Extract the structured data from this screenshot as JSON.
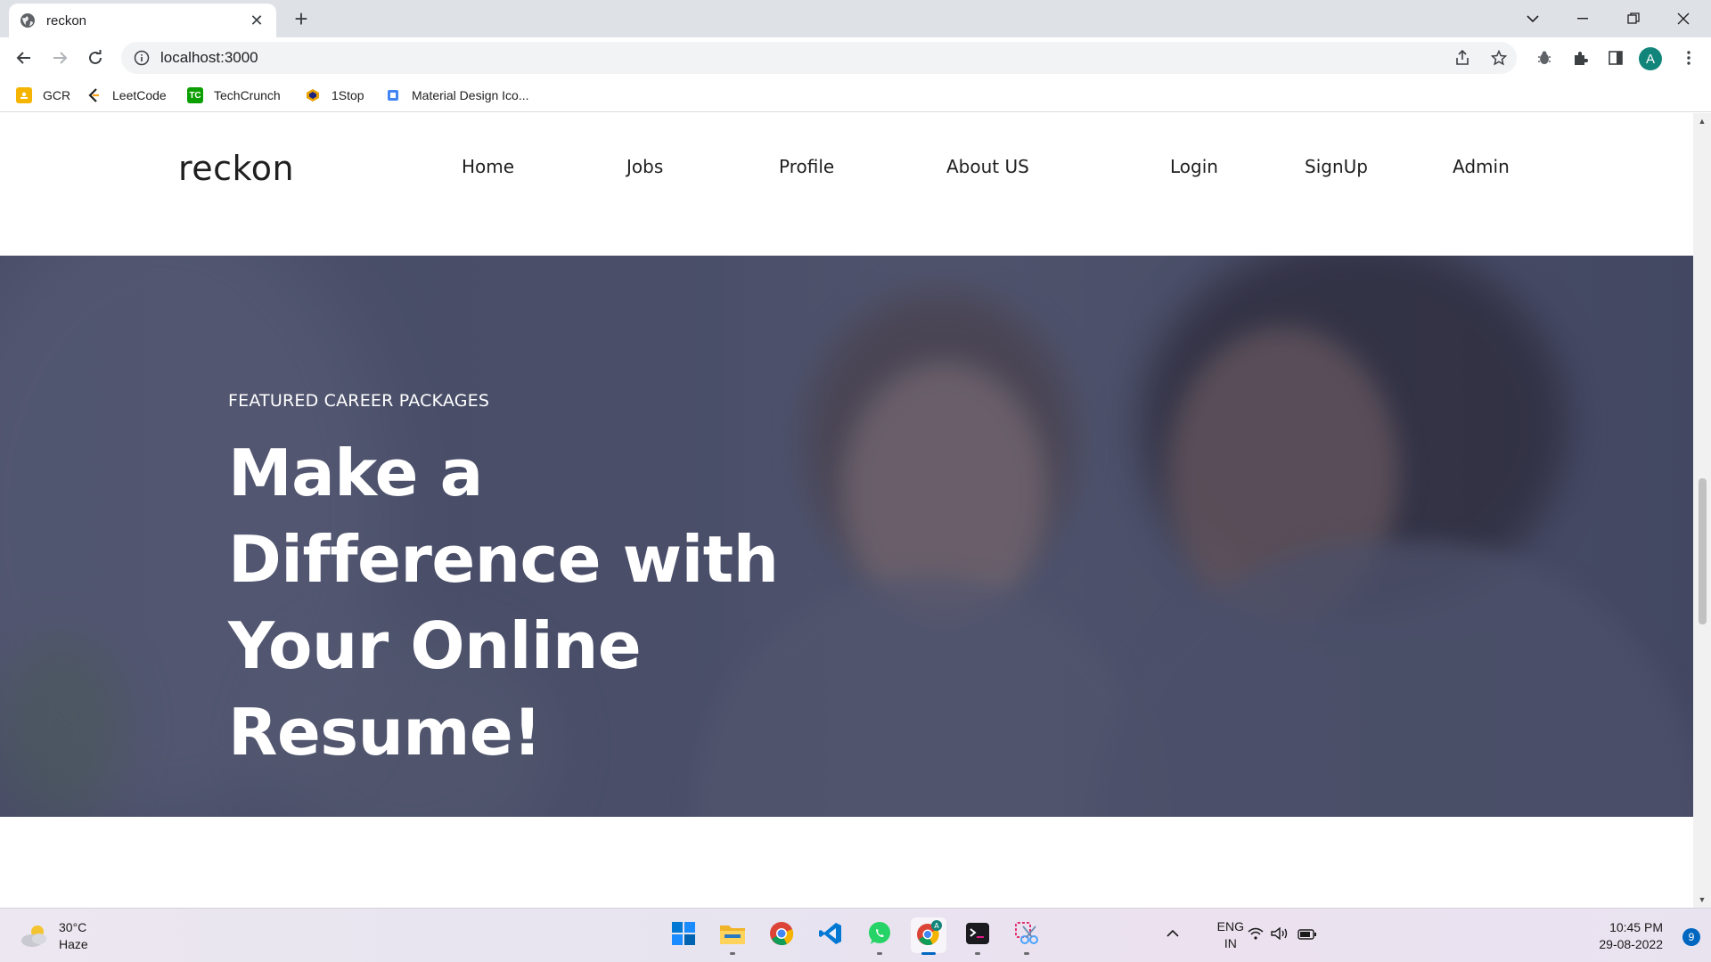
{
  "browser": {
    "tab_title": "reckon",
    "tab_close": "✕",
    "new_tab": "+",
    "url": "localhost:3000",
    "profile_initial": "A",
    "bookmarks": [
      {
        "label": "GCR",
        "icon": "google-classroom-icon",
        "color": "#f4b400"
      },
      {
        "label": "LeetCode",
        "icon": "leetcode-icon",
        "color": "#ffa116"
      },
      {
        "label": "TechCrunch",
        "icon": "techcrunch-icon",
        "color": "#0a9e01"
      },
      {
        "label": "1Stop",
        "icon": "1stop-icon",
        "color": "#e8a200"
      },
      {
        "label": "Material Design Ico...",
        "icon": "material-design-icon",
        "color": "#4285f4"
      }
    ]
  },
  "site": {
    "logo": "reckon",
    "nav": [
      "Home",
      "Jobs",
      "Profile",
      "About US",
      "Login",
      "SignUp",
      "Admin"
    ],
    "hero": {
      "eyebrow": "FEATURED CAREER PACKAGES",
      "headline": "Make a Difference with Your Online Resume!"
    }
  },
  "taskbar": {
    "weather_temp": "30°C",
    "weather_desc": "Haze",
    "apps": [
      "start",
      "file-explorer",
      "chrome",
      "vs-code",
      "whatsapp",
      "chrome-profile",
      "terminal",
      "snipping-tool"
    ],
    "lang_top": "ENG",
    "lang_bottom": "IN",
    "time": "10:45 PM",
    "date": "29-08-2022",
    "notifications": "9"
  },
  "colors": {
    "accent": "#0067c0",
    "hero_overlay": "#2e3454",
    "avatar": "#12857a"
  }
}
